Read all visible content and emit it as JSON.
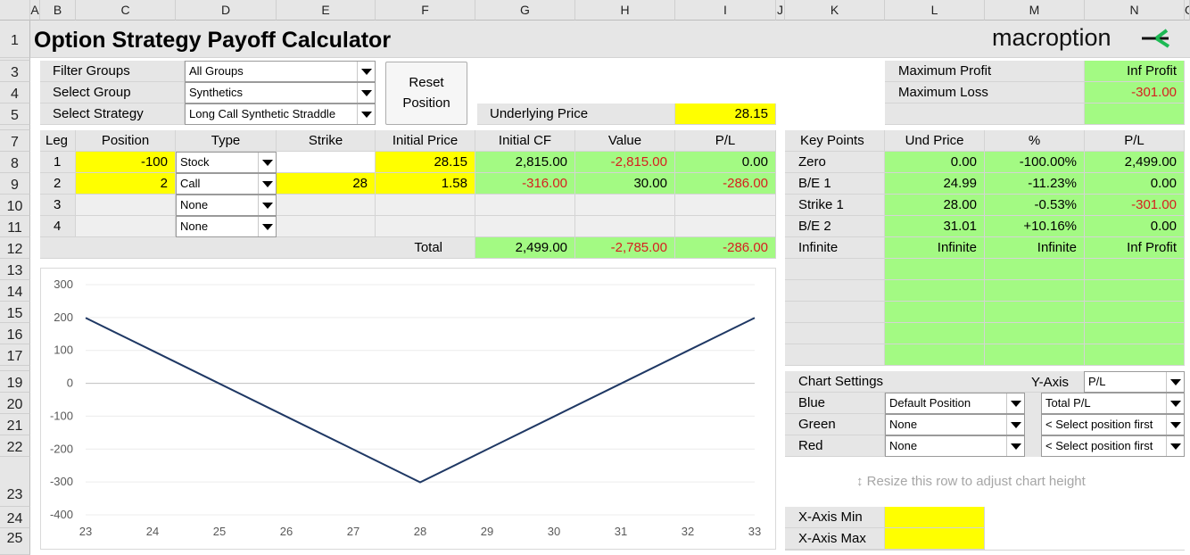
{
  "columns": [
    "A",
    "B",
    "C",
    "D",
    "E",
    "F",
    "G",
    "H",
    "I",
    "J",
    "K",
    "L",
    "M",
    "N",
    "O"
  ],
  "rows": [
    "1",
    "3",
    "4",
    "5",
    "7",
    "8",
    "9",
    "10",
    "11",
    "12",
    "13",
    "14",
    "15",
    "16",
    "17",
    "19",
    "20",
    "21",
    "22",
    "23",
    "24",
    "25"
  ],
  "title": "Option Strategy Payoff Calculator",
  "brand": "macroption",
  "filter": {
    "filter_label": "Filter Groups",
    "filter_value": "All Groups",
    "group_label": "Select Group",
    "group_value": "Synthetics",
    "strategy_label": "Select Strategy",
    "strategy_value": "Long Call Synthetic Straddle"
  },
  "reset_button": {
    "line1": "Reset",
    "line2": "Position"
  },
  "underlying": {
    "label": "Underlying Price",
    "value": "28.15"
  },
  "summary": {
    "max_profit_label": "Maximum Profit",
    "max_profit_value": "Inf Profit",
    "max_loss_label": "Maximum Loss",
    "max_loss_value": "-301.00"
  },
  "legs": {
    "headers": [
      "Leg",
      "Position",
      "Type",
      "Strike",
      "Initial Price",
      "Initial CF",
      "Value",
      "P/L"
    ],
    "rows": [
      {
        "leg": "1",
        "position": "-100",
        "type": "Stock",
        "strike": "",
        "price": "28.15",
        "cf": "2,815.00",
        "value": "-2,815.00",
        "pl": "0.00"
      },
      {
        "leg": "2",
        "position": "2",
        "type": "Call",
        "strike": "28",
        "price": "1.58",
        "cf": "-316.00",
        "value": "30.00",
        "pl": "-286.00"
      },
      {
        "leg": "3",
        "position": "",
        "type": "None",
        "strike": "",
        "price": "",
        "cf": "",
        "value": "",
        "pl": ""
      },
      {
        "leg": "4",
        "position": "",
        "type": "None",
        "strike": "",
        "price": "",
        "cf": "",
        "value": "",
        "pl": ""
      }
    ],
    "total_label": "Total",
    "total_cf": "2,499.00",
    "total_value": "-2,785.00",
    "total_pl": "-286.00"
  },
  "key_points": {
    "headers": [
      "Key Points",
      "Und Price",
      "%",
      "P/L"
    ],
    "rows": [
      {
        "name": "Zero",
        "price": "0.00",
        "pct": "-100.00%",
        "pl": "2,499.00"
      },
      {
        "name": "B/E 1",
        "price": "24.99",
        "pct": "-11.23%",
        "pl": "0.00"
      },
      {
        "name": "Strike 1",
        "price": "28.00",
        "pct": "-0.53%",
        "pl": "-301.00"
      },
      {
        "name": "B/E 2",
        "price": "31.01",
        "pct": "+10.16%",
        "pl": "0.00"
      },
      {
        "name": "Infinite",
        "price": "Infinite",
        "pct": "Infinite",
        "pl": "Inf Profit"
      }
    ]
  },
  "chart_settings": {
    "title": "Chart Settings",
    "yaxis_label": "Y-Axis",
    "yaxis_value": "P/L",
    "blue_label": "Blue",
    "blue_value": "Default Position",
    "blue_value2": "Total P/L",
    "green_label": "Green",
    "green_value": "None",
    "green_value2": "< Select position first",
    "red_label": "Red",
    "red_value": "None",
    "red_value2": "< Select position first"
  },
  "resize_hint": "Resize this row to adjust chart height",
  "xaxis": {
    "min_label": "X-Axis Min",
    "max_label": "X-Axis Max"
  },
  "colors": {
    "green": "#a3fa83",
    "yellow": "#ffff00",
    "red_text": "#d61f1f",
    "line": "#1f3864"
  },
  "chart_data": {
    "type": "line",
    "x": [
      23,
      24,
      25,
      26,
      27,
      28,
      29,
      30,
      31,
      32,
      33
    ],
    "series": [
      {
        "values": [
          199,
          99,
          -1,
          -101,
          -201,
          -301,
          -201,
          -101,
          -1,
          99,
          199
        ]
      }
    ],
    "xlim": [
      23,
      33
    ],
    "ylim": [
      -400,
      300
    ],
    "yticks": [
      "300",
      "200",
      "100",
      "0",
      "-100",
      "-200",
      "-300",
      "-400"
    ],
    "xticks": [
      "23",
      "24",
      "25",
      "26",
      "27",
      "28",
      "29",
      "30",
      "31",
      "32",
      "33"
    ],
    "grid": "horizontal"
  }
}
